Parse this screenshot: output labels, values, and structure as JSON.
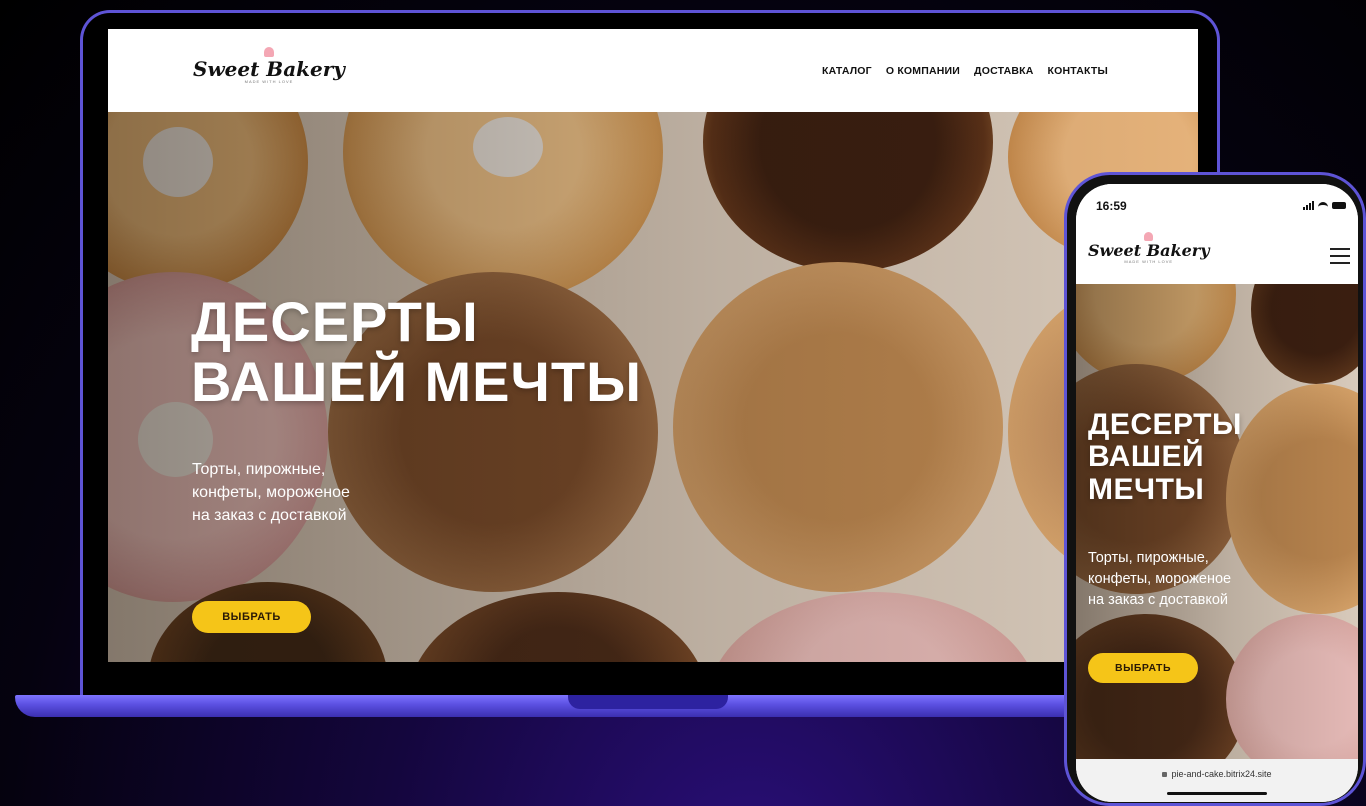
{
  "site": {
    "logo_text": "Sweet Bakery",
    "logo_tagline": "MADE WITH LOVE",
    "nav": [
      "КАТАЛОГ",
      "О КОМПАНИИ",
      "ДОСТАВКА",
      "КОНТАКТЫ"
    ],
    "hero": {
      "title_line1": "ДЕСЕРТЫ",
      "title_line2": "ВАШЕЙ МЕЧТЫ",
      "subtitle_line1": "Торты, пирожные,",
      "subtitle_line2": "конфеты, мороженое",
      "subtitle_line3": "на заказ с доставкой",
      "button": "ВЫБРАТЬ"
    }
  },
  "mobile": {
    "time": "16:59",
    "title_line1": "ДЕСЕРТЫ",
    "title_line2": "ВАШЕЙ",
    "title_line3": "МЕЧТЫ",
    "url": "pie-and-cake.bitrix24.site"
  },
  "colors": {
    "accent_yellow": "#f5c518",
    "device_frame": "#5e54d6",
    "background": "#14063d"
  },
  "icons": [
    "cupcake-icon",
    "menu-icon",
    "document-icon",
    "lock-icon",
    "signal-icon",
    "wifi-icon",
    "battery-icon"
  ]
}
